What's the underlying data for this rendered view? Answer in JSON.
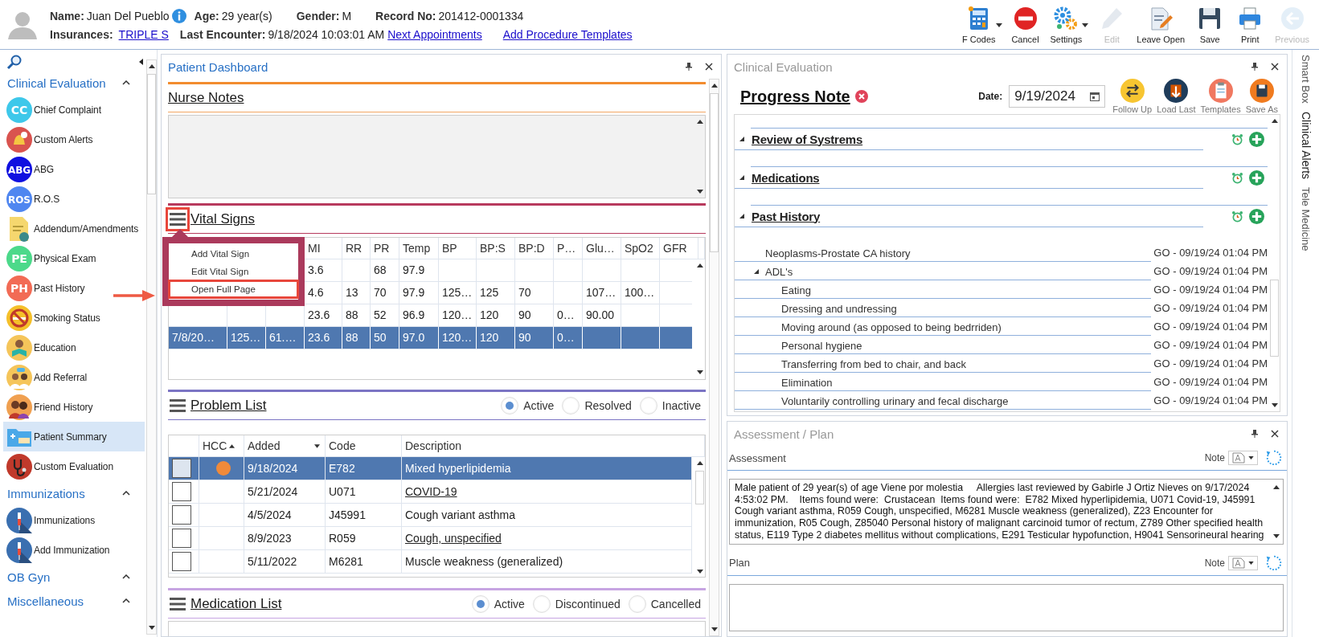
{
  "patient": {
    "name_label": "Name:",
    "name": "Juan Del Pueblo",
    "age_label": "Age:",
    "age": "29 year(s)",
    "gender_label": "Gender:",
    "gender": "M",
    "record_label": "Record No:",
    "record": "201412-0001334",
    "insurances_label": "Insurances:",
    "insurance": "TRIPLE S",
    "last_encounter_label": "Last Encounter:",
    "last_encounter": "9/18/2024 10:03:01 AM",
    "links": [
      "Next Appointments",
      "Add Procedure Templates"
    ]
  },
  "toolbar": [
    {
      "label": "F Codes",
      "kind": "fcodes",
      "dropdown": true,
      "disabled": false
    },
    {
      "label": "Cancel",
      "kind": "cancel",
      "dropdown": false,
      "disabled": false
    },
    {
      "label": "Settings",
      "kind": "settings",
      "dropdown": true,
      "disabled": false
    },
    {
      "label": "Edit",
      "kind": "edit",
      "dropdown": false,
      "disabled": true
    },
    {
      "label": "Leave Open",
      "kind": "leave_open",
      "dropdown": false,
      "disabled": false
    },
    {
      "label": "Save",
      "kind": "save",
      "dropdown": false,
      "disabled": false
    },
    {
      "label": "Print",
      "kind": "print",
      "dropdown": false,
      "disabled": false
    },
    {
      "label": "Previous",
      "kind": "previous",
      "dropdown": false,
      "disabled": true
    }
  ],
  "sidebar": {
    "groups": [
      {
        "title": "Clinical Evaluation",
        "items": [
          {
            "label": "Chief Complaint",
            "kind": "badge",
            "icon_text": "CC",
            "color": "#3ec8ea",
            "selected": false
          },
          {
            "label": "Custom Alerts",
            "kind": "bell",
            "color": "#d9534f",
            "selected": false
          },
          {
            "label": "ABG",
            "kind": "badge",
            "icon_text": "ABG",
            "color": "#1010e0",
            "selected": false
          },
          {
            "label": "R.O.S",
            "kind": "badge",
            "icon_text": "ROS",
            "color": "#4f86f0",
            "selected": false
          },
          {
            "label": "Addendum/Amendments",
            "kind": "note",
            "color": "#f5d76e",
            "selected": false
          },
          {
            "label": "Physical Exam",
            "kind": "badge",
            "icon_text": "PE",
            "color": "#4cd98a",
            "selected": false
          },
          {
            "label": "Past History",
            "kind": "badge",
            "icon_text": "PH",
            "color": "#f26b55",
            "selected": false
          },
          {
            "label": "Smoking Status",
            "kind": "nosmoke",
            "color": "#f5c02a",
            "selected": false
          },
          {
            "label": "Education",
            "kind": "reader",
            "color": "#f5c55a",
            "selected": false
          },
          {
            "label": "Add Referral",
            "kind": "referral",
            "color": "#f5c55a",
            "selected": false
          },
          {
            "label": "Friend History",
            "kind": "family",
            "color": "#f0a050",
            "selected": false
          },
          {
            "label": "Patient Summary",
            "kind": "folder",
            "color": "#4aa8e8",
            "selected": true
          },
          {
            "label": "Custom Evaluation",
            "kind": "stethoscope",
            "color": "#c0392b",
            "selected": false
          }
        ]
      },
      {
        "title": "Immunizations",
        "items": [
          {
            "label": "Immunizations",
            "kind": "syringe",
            "color": "#3a6fb0",
            "selected": false
          },
          {
            "label": "Add Immunization",
            "kind": "syringe",
            "color": "#3a6fb0",
            "selected": false
          }
        ]
      },
      {
        "title": "OB Gyn"
      },
      {
        "title": "Miscellaneous"
      }
    ]
  },
  "dashboard": {
    "title": "Patient Dashboard"
  },
  "nurse_notes": {
    "title": "Nurse Notes"
  },
  "vital_signs": {
    "title": "Vital Signs",
    "menu_button_highlighted": true,
    "menu": [
      {
        "label": "Add Vital Sign",
        "highlighted": false
      },
      {
        "label": "Edit Vital Sign",
        "highlighted": false
      },
      {
        "label": "Open Full Page",
        "highlighted": true
      }
    ],
    "columns": [
      null,
      null,
      null,
      "MI",
      "RR",
      "PR",
      "Temp",
      "BP",
      "BP:S",
      "BP:D",
      "P…",
      "Glu…",
      "SpO2",
      "GFR"
    ],
    "rows": [
      {
        "selected": false,
        "cells": [
          null,
          null,
          null,
          "3.6",
          null,
          "68",
          "97.9",
          null,
          null,
          null,
          null,
          null,
          null,
          null
        ]
      },
      {
        "selected": false,
        "cells": [
          null,
          null,
          null,
          "4.6",
          "13",
          "70",
          "97.9",
          "125…",
          "125",
          "70",
          null,
          "107…",
          "100…",
          null
        ]
      },
      {
        "selected": false,
        "cells": [
          null,
          null,
          null,
          "23.6",
          "88",
          "52",
          "96.9",
          "120…",
          "120",
          "90",
          "0…",
          "90.00",
          null,
          null
        ]
      },
      {
        "selected": true,
        "cells": [
          "7/8/20…",
          "125…",
          "61.…",
          "23.6",
          "88",
          "50",
          "97.0",
          "120…",
          "120",
          "90",
          "0…",
          null,
          null,
          null
        ]
      }
    ]
  },
  "problem_list": {
    "title": "Problem List",
    "filters": [
      {
        "label": "Active",
        "selected": true
      },
      {
        "label": "Resolved",
        "selected": false
      },
      {
        "label": "Inactive",
        "selected": false
      }
    ],
    "columns": [
      {
        "label": "HCC",
        "sort_descending": false
      },
      {
        "label": "Added",
        "sort_descending": true
      },
      {
        "label": "Code"
      },
      {
        "label": "Description"
      }
    ],
    "rows": [
      {
        "selected": true,
        "hcc": true,
        "added": "9/18/2024",
        "code": "E782",
        "description": "Mixed hyperlipidemia",
        "underlined": false
      },
      {
        "selected": false,
        "hcc": false,
        "added": "5/21/2024",
        "code": "U071",
        "description": "COVID-19",
        "underlined": true
      },
      {
        "selected": false,
        "hcc": false,
        "added": "4/5/2024",
        "code": "J45991",
        "description": "Cough variant asthma",
        "underlined": false
      },
      {
        "selected": false,
        "hcc": false,
        "added": "8/9/2023",
        "code": "R059",
        "description": "Cough, unspecified",
        "underlined": true
      },
      {
        "selected": false,
        "hcc": false,
        "added": "5/11/2022",
        "code": "M6281",
        "description": "Muscle weakness (generalized)",
        "underlined": false
      }
    ]
  },
  "medication_list": {
    "title": "Medication List",
    "filters": [
      {
        "label": "Active",
        "selected": true
      },
      {
        "label": "Discontinued",
        "selected": false
      },
      {
        "label": "Cancelled",
        "selected": false
      }
    ]
  },
  "clinical_evaluation": {
    "title": "Clinical Evaluation",
    "note_title": "Progress Note",
    "date_label": "Date:",
    "date": "9/19/2024",
    "actions": [
      {
        "label": "Follow Up",
        "kind": "followup"
      },
      {
        "label": "Load Last",
        "kind": "load_last"
      },
      {
        "label": "Templates",
        "kind": "templates"
      },
      {
        "label": "Save As",
        "kind": "save_as"
      }
    ],
    "sections": [
      {
        "title": "Review of Systrems"
      },
      {
        "title": "Medications"
      },
      {
        "title": "Past History",
        "entries": [
          {
            "label": "Neoplasms-Prostate CA history",
            "stamp": "GO - 09/19/24 01:04 PM"
          },
          {
            "label": "ADL's",
            "stamp": "GO - 09/19/24 01:04 PM",
            "expanded": true,
            "children": [
              {
                "label": "Eating",
                "stamp": "GO - 09/19/24 01:04 PM"
              },
              {
                "label": "Dressing and undressing",
                "stamp": "GO - 09/19/24 01:04 PM"
              },
              {
                "label": "Moving around (as opposed to being bedrriden)",
                "stamp": "GO - 09/19/24 01:04 PM"
              },
              {
                "label": "Personal hygiene",
                "stamp": "GO - 09/19/24 01:04 PM"
              },
              {
                "label": "Transferring from bed to chair, and back",
                "stamp": "GO - 09/19/24 01:04 PM"
              },
              {
                "label": "Elimination",
                "stamp": "GO - 09/19/24 01:04 PM"
              },
              {
                "label": "Voluntarily controlling urinary and fecal discharge",
                "stamp": "GO - 09/19/24 01:04 PM"
              }
            ]
          }
        ]
      }
    ]
  },
  "assessment_plan": {
    "title": "Assessment / Plan",
    "fields": [
      {
        "label": "Assessment",
        "note_label": "Note",
        "value": "Male patient of 29 year(s) of age Viene por molestia     Allergies last reviewed by Gabirle J Ortiz Nieves on 9/17/2024 4:53:02 PM.    Items found were:  Crustacean  Items found were:  E782 Mixed hyperlipidemia, U071 Covid-19, J45991 Cough variant asthma, R059 Cough, unspecified, M6281 Muscle weakness (generalized), Z23 Encounter for immunization, R05 Cough, Z85040 Personal history of malignant carcinoid tumor of rectum, Z789 Other specified health status, E119 Type 2 diabetes mellitus without complications, E291 Testicular hypofunction, H9041 Sensorineural hearing"
      },
      {
        "label": "Plan",
        "note_label": "Note"
      }
    ]
  },
  "side_tabs": [
    {
      "label": "Smart Box",
      "selected": false
    },
    {
      "label": "Clinical Alerts",
      "selected": true
    },
    {
      "label": "Tele Medicine",
      "selected": false
    }
  ]
}
